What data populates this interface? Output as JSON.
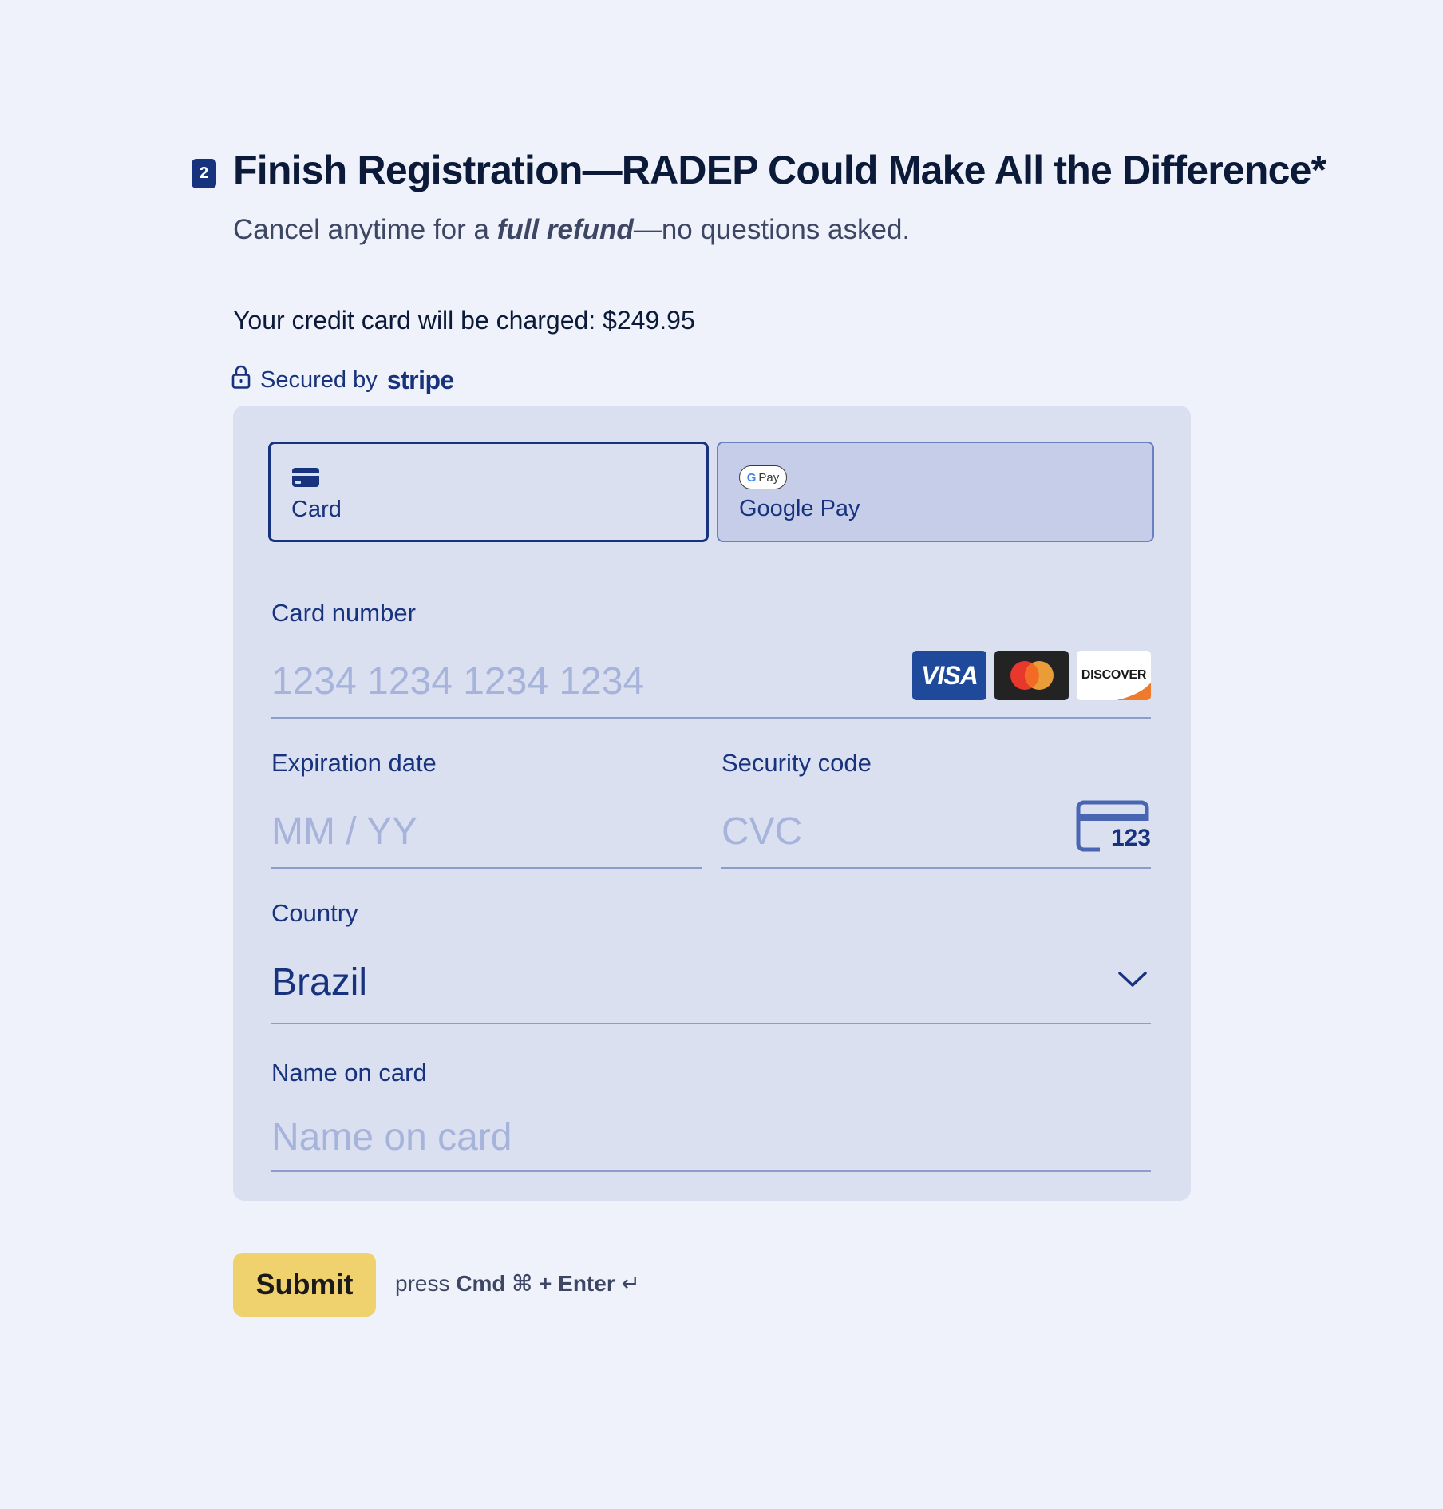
{
  "question": {
    "step_number": "2",
    "title": "Finish Registration—RADEP Could Make All the Difference*",
    "subtitle_pre": "Cancel anytime for a ",
    "subtitle_emphasis": "full refund",
    "subtitle_post": "—no questions asked."
  },
  "charge": {
    "text": "Your credit card will be charged: $249.95"
  },
  "secured": {
    "prefix": "Secured by",
    "brand": "stripe",
    "icon": "lock-icon"
  },
  "payment_methods": [
    {
      "label": "Card",
      "icon": "credit-card-icon",
      "selected": true
    },
    {
      "label": "Google Pay",
      "icon": "google-pay-icon",
      "selected": false
    }
  ],
  "gpay_pill": {
    "g": "G",
    "text": "Pay"
  },
  "card_number": {
    "label": "Card number",
    "placeholder": "1234 1234 1234 1234",
    "value": "",
    "brands": [
      "VISA",
      "Mastercard",
      "DISCOVER"
    ]
  },
  "expiration": {
    "label": "Expiration date",
    "placeholder": "MM / YY",
    "value": ""
  },
  "security_code": {
    "label": "Security code",
    "placeholder": "CVC",
    "value": "",
    "icon_text": "123"
  },
  "country": {
    "label": "Country",
    "selected": "Brazil"
  },
  "name_on_card": {
    "label": "Name on card",
    "placeholder": "Name on card",
    "value": ""
  },
  "submit": {
    "label": "Submit",
    "hint_press": "press",
    "hint_keys": "Cmd ⌘ + Enter",
    "hint_symbol": "↵"
  },
  "colors": {
    "page_bg": "#eff2fa",
    "accent": "#17337e",
    "panel_bg": "#dbe0f1",
    "button_bg": "#efd26e",
    "placeholder": "#a6b3db"
  }
}
